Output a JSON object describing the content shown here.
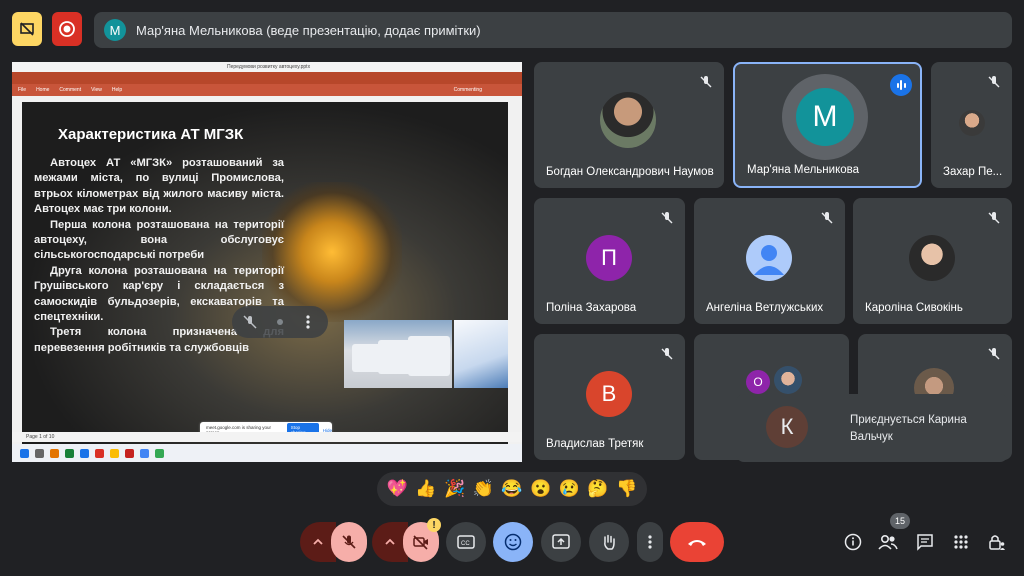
{
  "presenter_bar": {
    "avatar_letter": "M",
    "title": "Мар'яна Мельникова (веде презентацію, додає примітки)"
  },
  "presentation": {
    "window_title": "Передумови розвитку автоцеху.pptx",
    "menu": [
      "File",
      "Home",
      "Comment",
      "View",
      "Help"
    ],
    "collab_label": "Commenting",
    "slide_title": "Характеристика АТ МГЗК",
    "paragraphs": [
      "Автоцех АТ «МГЗК» розташований за межами міста, по вулиці Промислова, втрьох кілометрах від жилого масиву міста. Автоцех має три колони.",
      "Перша колона розташована на території автоцеху, вона обслуговує сільськогосподарські потреби",
      "Друга колона розташована на території Грушівського кар'єру і складається з самоскидів бульдозерів, екскаваторів та спецтехніки.",
      "Третя колона призначена для перевезення робітників та службовців"
    ],
    "status": "Page 1 of 10",
    "share_text": "meet.google.com is sharing your screen.",
    "stop_sharing": "Stop sharing",
    "hide": "Hide"
  },
  "tiles": [
    {
      "name": "Богдан Олександрович Наумов",
      "avatar": "photo"
    },
    {
      "name": "Мар'яна Мельникова",
      "avatar_letter": "M",
      "color": "#12939a",
      "speaking": true
    },
    {
      "name": "Захар Пе...",
      "avatar": "photo"
    },
    {
      "name": "Поліна Захарова",
      "avatar_letter": "П",
      "color": "#8e24aa"
    },
    {
      "name": "Ангеліна Ветлужських",
      "avatar": "default"
    },
    {
      "name": "Кароліна Сивокінь",
      "avatar": "photo"
    },
    {
      "name": "Владислав Третяк",
      "avatar_letter": "В",
      "color": "#d9452c"
    },
    {
      "name": "",
      "avatar_letter": "О",
      "color": "#8e24aa"
    },
    {
      "name": "",
      "avatar": "photo"
    }
  ],
  "join_toast": {
    "letter": "К",
    "text": "Приєднується Карина Вальчук"
  },
  "reactions": [
    "💖",
    "👍",
    "🎉",
    "👏",
    "😂",
    "😮",
    "😢",
    "🤔",
    "👎"
  ],
  "controls": {
    "participants_count": "15",
    "warning": "!"
  },
  "colors": {
    "background": "#202124",
    "tile": "#3c4043",
    "end_call": "#ea4335",
    "mic_off": "#f6aea9",
    "active_border": "#8ab4f8"
  }
}
